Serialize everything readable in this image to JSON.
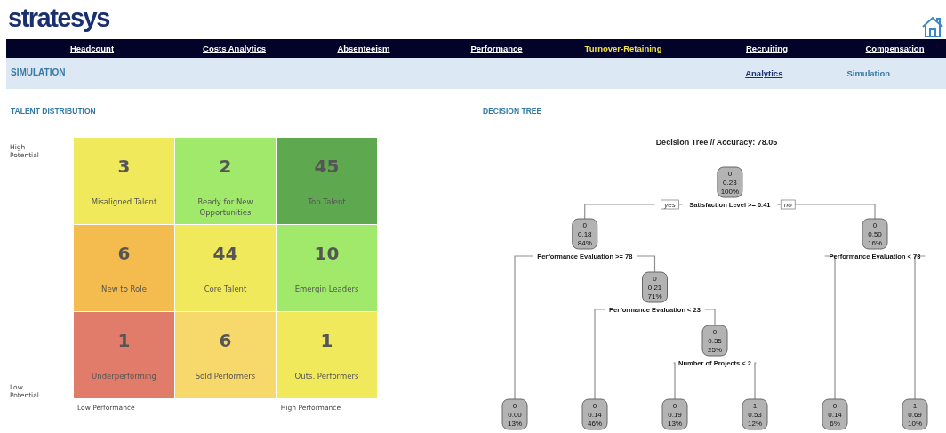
{
  "logo": {
    "text": "stratesys"
  },
  "nav": [
    {
      "label": "Headcount",
      "selected": false
    },
    {
      "label": "Costs Analytics",
      "selected": false
    },
    {
      "label": "Absenteeism",
      "selected": false
    },
    {
      "label": "Performance",
      "selected": false
    },
    {
      "label": "Turnover-Retaining",
      "selected": true
    },
    {
      "label": "Recruiting",
      "selected": false
    },
    {
      "label": "Compensation",
      "selected": false
    }
  ],
  "subnav": {
    "title": "SIMULATION",
    "links": [
      {
        "label": "Analytics",
        "selected": false
      },
      {
        "label": "Simulation",
        "selected": true
      }
    ]
  },
  "talent_distribution": {
    "heading": "TALENT DISTRIBUTION",
    "y_high": "High Potential",
    "y_low": "Low Potential",
    "x_low": "Low Performance",
    "x_high": "High Performance",
    "cells": [
      {
        "count": "3",
        "label": "Misaligned Talent",
        "color": "#f0e95c"
      },
      {
        "count": "2",
        "label": "Ready for New Opportunities",
        "color": "#a0e96b"
      },
      {
        "count": "45",
        "label": "Top Talent",
        "color": "#5ea850"
      },
      {
        "count": "6",
        "label": "New to Role",
        "color": "#f4bb4e"
      },
      {
        "count": "44",
        "label": "Core Talent",
        "color": "#f0e95c"
      },
      {
        "count": "10",
        "label": "Emergin Leaders",
        "color": "#a0e96b"
      },
      {
        "count": "1",
        "label": "Underperforming",
        "color": "#e27c6a"
      },
      {
        "count": "6",
        "label": "Sold Performers",
        "color": "#f7d86a"
      },
      {
        "count": "1",
        "label": "Outs. Performers",
        "color": "#f0e95c"
      }
    ]
  },
  "decision_tree": {
    "heading": "DECISION TREE",
    "title": "Decision Tree // Accuracy: 78.05",
    "root": {
      "lines": [
        "0",
        "0.23",
        "100%"
      ],
      "split": "Satisfaction Level >= 0.41",
      "yes_label": "yes",
      "no_label": "no",
      "children": [
        {
          "lines": [
            "0",
            "0.18",
            "84%"
          ],
          "split": "Performance Evaluation >= 78",
          "children": [
            {
              "lines": [
                "0",
                "0.00",
                "13%"
              ]
            },
            {
              "lines": [
                "0",
                "0.21",
                "71%"
              ],
              "split": "Performance Evaluation < 23",
              "children": [
                {
                  "lines": [
                    "0",
                    "0.14",
                    "46%"
                  ]
                },
                {
                  "lines": [
                    "0",
                    "0.35",
                    "25%"
                  ],
                  "split": "Number of Projects < 2",
                  "children": [
                    {
                      "lines": [
                        "0",
                        "0.19",
                        "13%"
                      ]
                    },
                    {
                      "lines": [
                        "1",
                        "0.53",
                        "12%"
                      ]
                    }
                  ]
                }
              ]
            }
          ]
        },
        {
          "lines": [
            "0",
            "0.50",
            "16%"
          ],
          "split": "Performance Evaluation < 73",
          "children": [
            {
              "lines": [
                "0",
                "0.14",
                "6%"
              ]
            },
            {
              "lines": [
                "1",
                "0.69",
                "10%"
              ]
            }
          ]
        }
      ]
    }
  }
}
